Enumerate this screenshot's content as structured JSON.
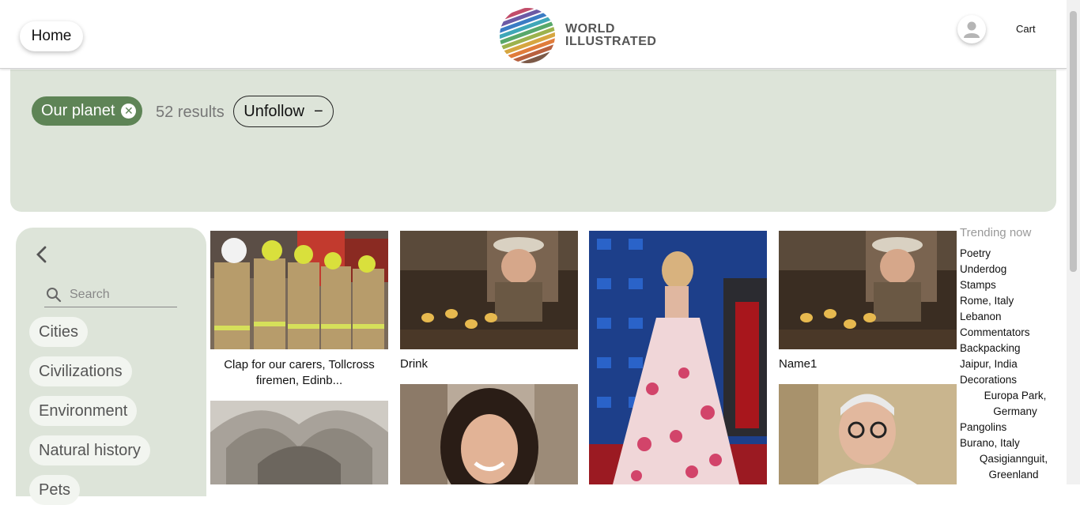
{
  "header": {
    "home_label": "Home",
    "logo_line1": "WORLD",
    "logo_line2": "ILLUSTRATED",
    "cart_label": "Cart"
  },
  "filter": {
    "tag_label": "Our planet",
    "results_text": "52 results",
    "unfollow_label": "Unfollow",
    "unfollow_symbol": "−"
  },
  "sidebar": {
    "search_placeholder": "Search",
    "categories": [
      "Cities",
      "Civilizations",
      "Environment",
      "Natural history",
      "Pets"
    ]
  },
  "cards": [
    {
      "caption": "Clap for our carers, Tollcross firemen, Edinb..."
    },
    {
      "caption": "Drink"
    },
    {
      "caption": ""
    },
    {
      "caption": "Name1"
    }
  ],
  "trending": {
    "title": "Trending now",
    "items": [
      "Poetry",
      "Underdog",
      "Stamps",
      "Rome, Italy",
      "Lebanon",
      "Commentators",
      "Backpacking",
      "Jaipur, India",
      "Decorations",
      "Europa Park, Germany",
      "Pangolins",
      "Burano, Italy",
      "Qasigiannguit, Greenland"
    ]
  },
  "colors": {
    "accent_green": "#5e8456",
    "panel_bg": "#dde4d9"
  }
}
